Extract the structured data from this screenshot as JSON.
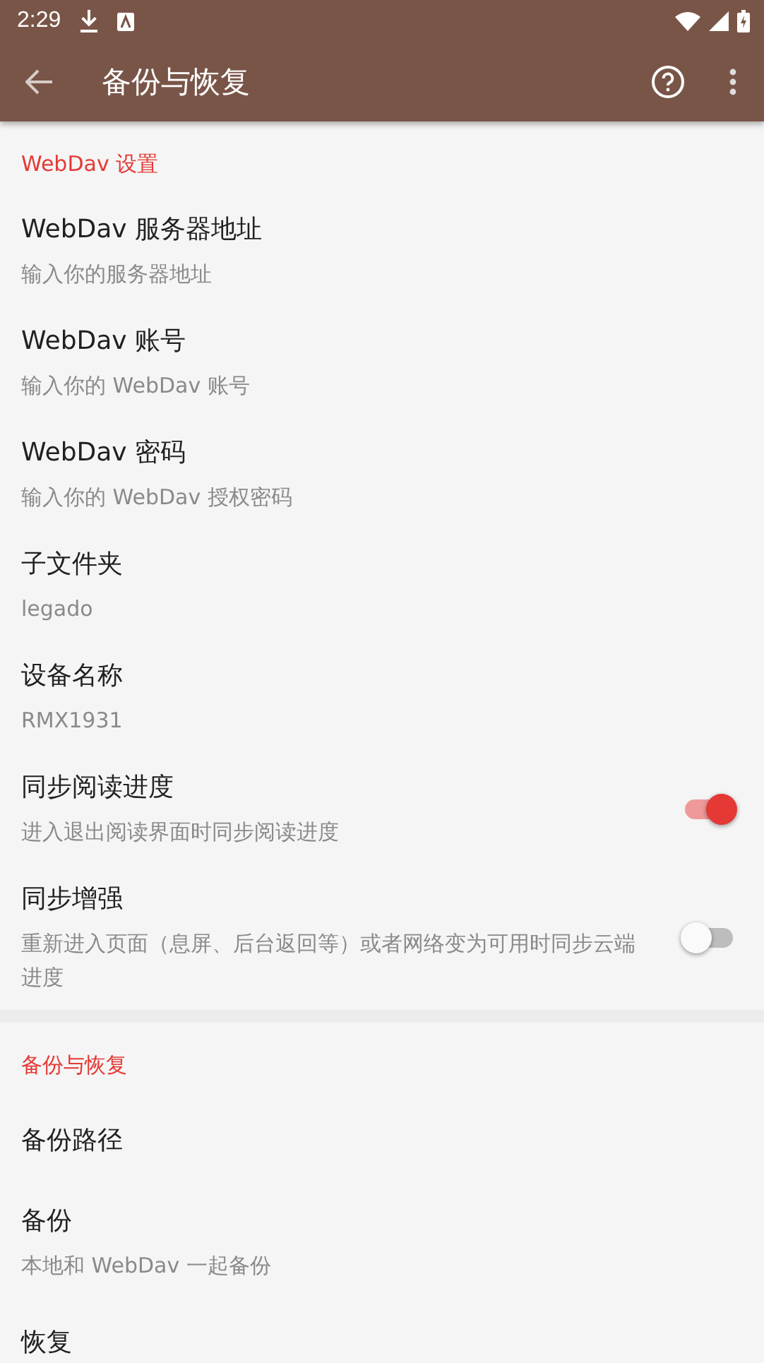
{
  "status_bar": {
    "time": "2:29"
  },
  "app_bar": {
    "title": "备份与恢复"
  },
  "sections": [
    {
      "header": "WebDav 设置",
      "items": [
        {
          "kind": "text",
          "title": "WebDav 服务器地址",
          "summary": "输入你的服务器地址"
        },
        {
          "kind": "text",
          "title": "WebDav 账号",
          "summary": "输入你的 WebDav 账号"
        },
        {
          "kind": "text",
          "title": "WebDav 密码",
          "summary": "输入你的 WebDav 授权密码"
        },
        {
          "kind": "text",
          "title": "子文件夹",
          "summary": "legado"
        },
        {
          "kind": "text",
          "title": "设备名称",
          "summary": "RMX1931"
        },
        {
          "kind": "switch",
          "title": "同步阅读进度",
          "summary": "进入退出阅读界面时同步阅读进度",
          "on": true
        },
        {
          "kind": "switch",
          "title": "同步增强",
          "summary": "重新进入页面（息屏、后台返回等）或者网络变为可用时同步云端进度",
          "on": false
        }
      ]
    },
    {
      "header": "备份与恢复",
      "items": [
        {
          "kind": "text",
          "title": "备份路径"
        },
        {
          "kind": "text",
          "title": "备份",
          "summary": "本地和 WebDav 一起备份"
        },
        {
          "kind": "text",
          "title": "恢复"
        }
      ]
    }
  ]
}
